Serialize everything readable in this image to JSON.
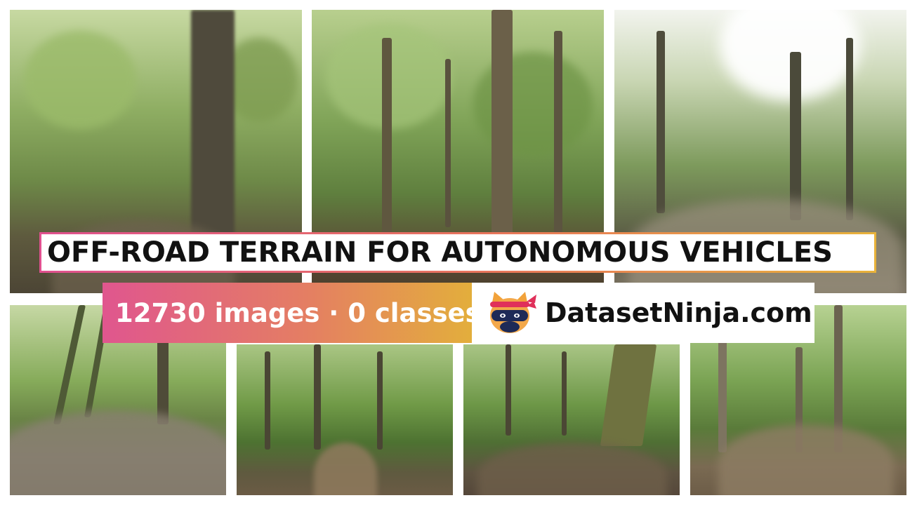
{
  "title": "OFF-ROAD TERRAIN FOR AUTONOMOUS VEHICLES",
  "stats": "12730 images · 0 classes",
  "brand": "DatasetNinja.com",
  "icons": {
    "logo": "ninja-cat-logo-icon"
  },
  "colors": {
    "gradient_start": "#e0508f",
    "gradient_mid": "#e8765a",
    "gradient_end": "#e8b23a",
    "title_text": "#111111",
    "stats_text": "#ffffff"
  }
}
